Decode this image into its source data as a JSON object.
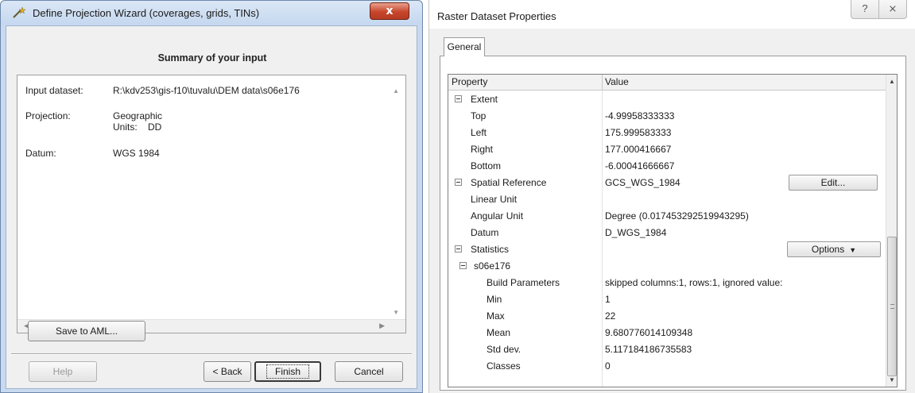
{
  "wizard": {
    "title": "Define Projection Wizard (coverages, grids, TINs)",
    "close_label": "x",
    "summary_title": "Summary of your input",
    "fields": [
      {
        "label": "Input dataset:",
        "value": "R:\\kdv253\\gis-f10\\tuvalu\\DEM data\\s06e176"
      },
      {
        "label": "Projection:",
        "value": "Geographic"
      },
      {
        "label": "Datum:",
        "value": "WGS 1984"
      }
    ],
    "units_label": "Units:",
    "units_value": "DD",
    "buttons": {
      "save_aml": "Save to AML...",
      "help": "Help",
      "back": "< Back",
      "finish": "Finish",
      "cancel": "Cancel"
    }
  },
  "raster_props": {
    "title": "Raster Dataset Properties",
    "help_btn": "?",
    "close_btn": "⨯",
    "tab": "General",
    "columns": [
      "Property",
      "Value"
    ],
    "rows": [
      {
        "prop": "Extent",
        "value": ""
      },
      {
        "prop": "Top",
        "value": "-4.99958333333"
      },
      {
        "prop": "Left",
        "value": "175.999583333"
      },
      {
        "prop": "Right",
        "value": "177.000416667"
      },
      {
        "prop": "Bottom",
        "value": "-6.00041666667"
      },
      {
        "prop": "Spatial Reference",
        "value": "GCS_WGS_1984"
      },
      {
        "prop": "Linear Unit",
        "value": ""
      },
      {
        "prop": "Angular Unit",
        "value": "Degree (0.017453292519943295)"
      },
      {
        "prop": "Datum",
        "value": "D_WGS_1984"
      },
      {
        "prop": "Statistics",
        "value": ""
      },
      {
        "prop": "s06e176",
        "value": ""
      },
      {
        "prop": "Build Parameters",
        "value": "skipped columns:1, rows:1, ignored value:"
      },
      {
        "prop": "Min",
        "value": "1"
      },
      {
        "prop": "Max",
        "value": "22"
      },
      {
        "prop": "Mean",
        "value": "9.680776014109348"
      },
      {
        "prop": "Std dev.",
        "value": "5.117184186735583"
      },
      {
        "prop": "Classes",
        "value": "0"
      }
    ],
    "edit_button": "Edit...",
    "options_button": "Options"
  }
}
